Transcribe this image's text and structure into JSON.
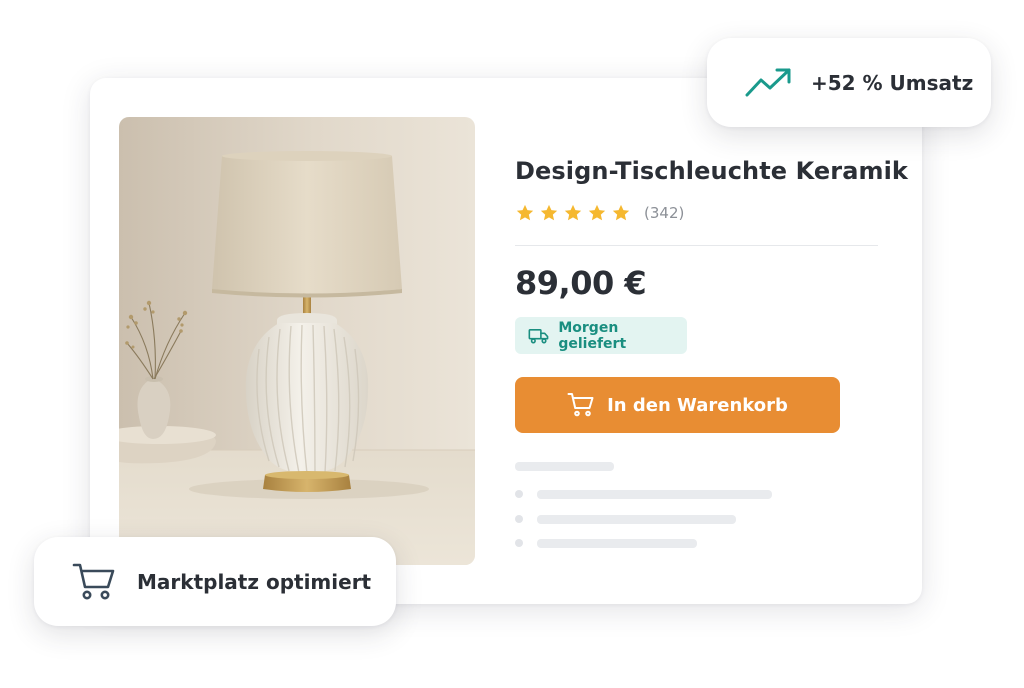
{
  "product": {
    "title": "Design-Tischleuchte Keramik",
    "rating": 5,
    "review_count": "(342)",
    "price": "89,00 €",
    "delivery_badge": "Morgen geliefert",
    "add_to_cart_label": "In den Warenkorb",
    "image_alt": "Keramik-Tischleuchte mit Leinenschirm"
  },
  "sales_badge": {
    "label": "+52 % Umsatz",
    "icon": "trend-up-icon"
  },
  "marketplace_badge": {
    "label": "Marktplatz optimiert",
    "icon": "cart-icon"
  },
  "colors": {
    "accent": "#e88d33",
    "star": "#f5b830",
    "delivery_text": "#1a8e80",
    "delivery_bg": "#e3f4f1",
    "trend": "#1a9a8c",
    "icon_dark": "#3a4a5a"
  }
}
